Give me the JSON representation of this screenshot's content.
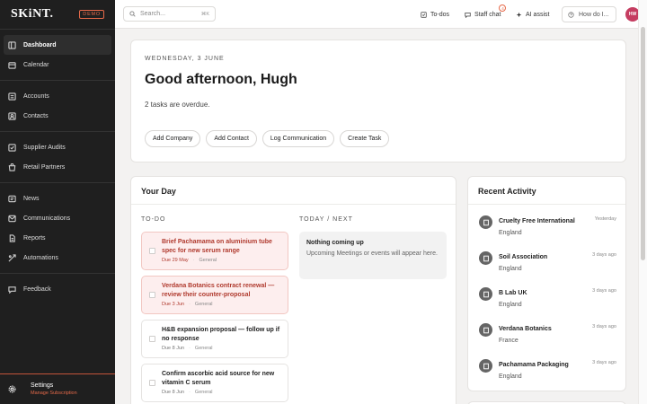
{
  "brand": {
    "logo": "SKiNT.",
    "badge": "DEMO"
  },
  "sidebar": {
    "groups": [
      [
        {
          "label": "Dashboard",
          "icon": "dashboard-icon",
          "active": true
        },
        {
          "label": "Calendar",
          "icon": "calendar-icon"
        }
      ],
      [
        {
          "label": "Accounts",
          "icon": "accounts-icon"
        },
        {
          "label": "Contacts",
          "icon": "contacts-icon"
        }
      ],
      [
        {
          "label": "Supplier Audits",
          "icon": "audit-icon"
        },
        {
          "label": "Retail Partners",
          "icon": "retail-icon"
        }
      ],
      [
        {
          "label": "News",
          "icon": "news-icon"
        },
        {
          "label": "Communications",
          "icon": "communications-icon"
        },
        {
          "label": "Reports",
          "icon": "reports-icon"
        },
        {
          "label": "Automations",
          "icon": "automations-icon"
        }
      ],
      [
        {
          "label": "Feedback",
          "icon": "feedback-icon"
        }
      ]
    ],
    "footer": {
      "title": "Settings",
      "subtitle": "Manage Subscription"
    }
  },
  "topbar": {
    "search_placeholder": "Search...",
    "search_shortcut": "⌘K",
    "todos_label": "To-dos",
    "staff_chat_label": "Staff chat",
    "staff_chat_count": "4",
    "ai_assist_label": "AI assist",
    "help_label": "How do I...",
    "avatar_initials": "HW"
  },
  "greeting": {
    "date": "WEDNESDAY, 3 JUNE",
    "headline": "Good afternoon, Hugh",
    "overdue_text": "2 tasks are overdue.",
    "actions": [
      "Add Company",
      "Add Contact",
      "Log Communication",
      "Create Task"
    ]
  },
  "your_day": {
    "title": "Your Day",
    "todo_heading": "TO-DO",
    "next_heading": "TODAY / NEXT",
    "tasks": [
      {
        "title": "Brief Pachamama on aluminium tube spec for new serum range",
        "due": "Due 29 May",
        "tag": "General",
        "overdue": true
      },
      {
        "title": "Verdana Botanics contract renewal — review their counter-proposal",
        "due": "Due 3 Jun",
        "tag": "General",
        "overdue": true
      },
      {
        "title": "H&B expansion proposal — follow up if no response",
        "due": "Due 8 Jun",
        "tag": "General",
        "overdue": false
      },
      {
        "title": "Confirm ascorbic acid source for new vitamin C serum",
        "due": "Due 8 Jun",
        "tag": "General",
        "overdue": false
      }
    ],
    "next": {
      "title": "Nothing coming up",
      "text": "Upcoming Meetings or events will appear here."
    }
  },
  "recent_activity": {
    "title": "Recent Activity",
    "items": [
      {
        "name": "Cruelty Free International",
        "location": "England",
        "time": "Yesterday"
      },
      {
        "name": "Soil Association",
        "location": "England",
        "time": "3 days ago"
      },
      {
        "name": "B Lab UK",
        "location": "England",
        "time": "3 days ago"
      },
      {
        "name": "Verdana Botanics",
        "location": "France",
        "time": "3 days ago"
      },
      {
        "name": "Pachamama Packaging",
        "location": "England",
        "time": "3 days ago"
      }
    ]
  },
  "colors": {
    "sidebar_bg": "#1f1f1f",
    "accent": "#e66a4a",
    "avatar": "#c53d61",
    "overdue_bg": "#fdeeee",
    "overdue_text": "#b03a2e"
  }
}
